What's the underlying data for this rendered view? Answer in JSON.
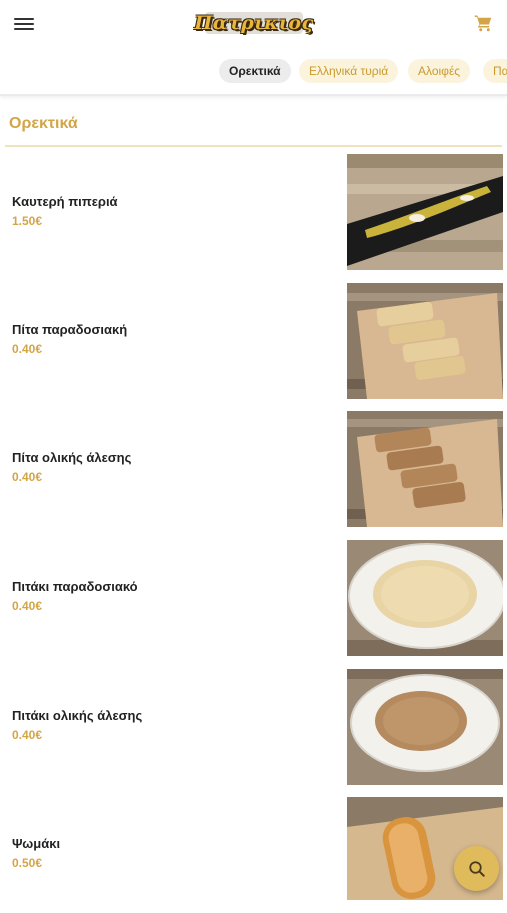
{
  "app": {
    "brand": "Πατρικιος"
  },
  "header": {
    "menu_icon": "hamburger-menu-icon",
    "cart_icon": "shopping-cart-icon"
  },
  "tabs": [
    {
      "label": "Ορεκτικά",
      "active": true
    },
    {
      "label": "Ελληνικά τυριά",
      "active": false
    },
    {
      "label": "Αλοιφές",
      "active": false
    },
    {
      "label": "Πα",
      "active": false
    }
  ],
  "section": {
    "title": "Ορεκτικά"
  },
  "items": [
    {
      "name": "Καυτερή πιπεριά",
      "price": "1.50€"
    },
    {
      "name": "Πίτα παραδοσιακή",
      "price": "0.40€"
    },
    {
      "name": "Πίτα ολικής άλεσης",
      "price": "0.40€"
    },
    {
      "name": "Πιτάκι παραδοσιακό",
      "price": "0.40€"
    },
    {
      "name": "Πιτάκι ολικής άλεσης",
      "price": "0.40€"
    },
    {
      "name": "Ψωμάκι",
      "price": "0.50€"
    }
  ],
  "fab": {
    "icon": "search-icon"
  },
  "colors": {
    "accent": "#d2a648",
    "accent_light": "#fbf3dc",
    "fab": "#e0bb5c"
  }
}
